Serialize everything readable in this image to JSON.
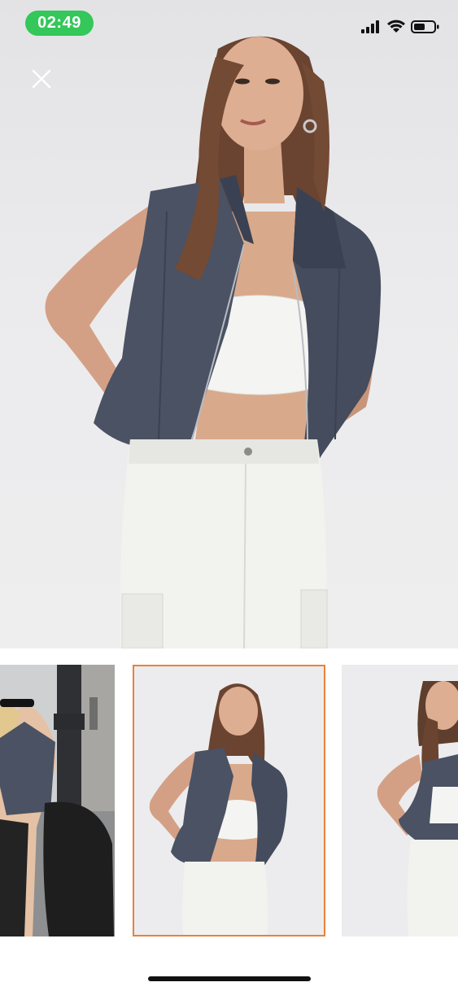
{
  "status_bar": {
    "time": "02:49",
    "time_pill_color": "#34c759",
    "icons": [
      "cellular-signal-icon",
      "wifi-icon",
      "battery-icon"
    ]
  },
  "gallery": {
    "close_icon": "close-icon",
    "main_image": "model-wearing-navy-zip-vest-white-crop-top-white-cargo-jeans",
    "thumbnails": [
      {
        "image": "street-photo-vest-with-sunglasses",
        "selected": false
      },
      {
        "image": "studio-front-vest",
        "selected": true
      },
      {
        "image": "studio-side-vest",
        "selected": false
      }
    ],
    "selected_border_color": "#e8813a"
  }
}
